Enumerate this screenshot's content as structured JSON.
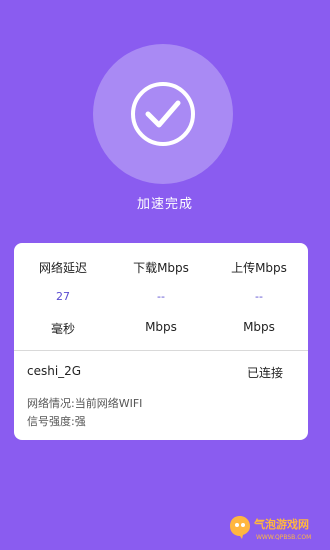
{
  "status": {
    "text": "加速完成",
    "icon": "check-circle-icon"
  },
  "stats": [
    {
      "label": "网络延迟",
      "value": "27",
      "unit": "毫秒"
    },
    {
      "label": "下载Mbps",
      "value": "--",
      "unit": "Mbps"
    },
    {
      "label": "上传Mbps",
      "value": "--",
      "unit": "Mbps"
    }
  ],
  "network": {
    "name": "ceshi_2G",
    "connection_status": "已连接",
    "situation": "网络情况:当前网络WIFI",
    "signal": "信号强度:强"
  },
  "watermark": {
    "text": "气泡游戏网",
    "url": "WWW.QPBSB.COM"
  },
  "colors": {
    "background": "#8a5cf0",
    "circle": "#a98af4",
    "accent_value": "#5a4cd0",
    "watermark": "#ffb640"
  }
}
